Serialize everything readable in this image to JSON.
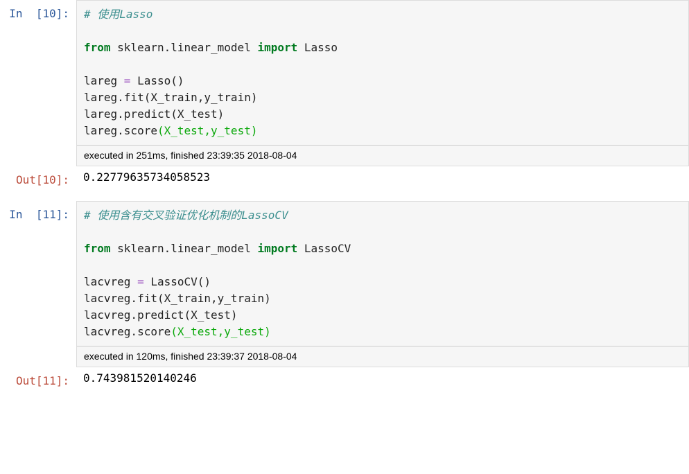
{
  "cells": [
    {
      "in_prompt": "In  [10]:",
      "out_prompt": "Out[10]:",
      "code": {
        "comment": "# 使用Lasso",
        "kw_from": "from",
        "mod1": " sklearn.linear_model ",
        "kw_import": "import",
        "imp1": " Lasso",
        "l1a": "lareg ",
        "l1op": "=",
        "l1b": " Lasso",
        "l1p": "()",
        "l2": "lareg.fit",
        "l2p": "(X_train,y_train)",
        "l3": "lareg.predict",
        "l3p": "(X_test)",
        "l4": "lareg.score",
        "l4p": "(X_test,y_test)"
      },
      "exec": "executed in 251ms, finished 23:39:35 2018-08-04",
      "output": "0.22779635734058523"
    },
    {
      "in_prompt": "In  [11]:",
      "out_prompt": "Out[11]:",
      "code": {
        "comment": "# 使用含有交叉验证优化机制的LassoCV",
        "kw_from": "from",
        "mod1": " sklearn.linear_model ",
        "kw_import": "import",
        "imp1": " LassoCV",
        "l1a": "lacvreg ",
        "l1op": "=",
        "l1b": " LassoCV",
        "l1p": "()",
        "l2": "lacvreg.fit",
        "l2p": "(X_train,y_train)",
        "l3": "lacvreg.predict",
        "l3p": "(X_test)",
        "l4": "lacvreg.score",
        "l4p": "(X_test,y_test)"
      },
      "exec": "executed in 120ms, finished 23:39:37 2018-08-04",
      "output": "0.743981520140246"
    }
  ]
}
